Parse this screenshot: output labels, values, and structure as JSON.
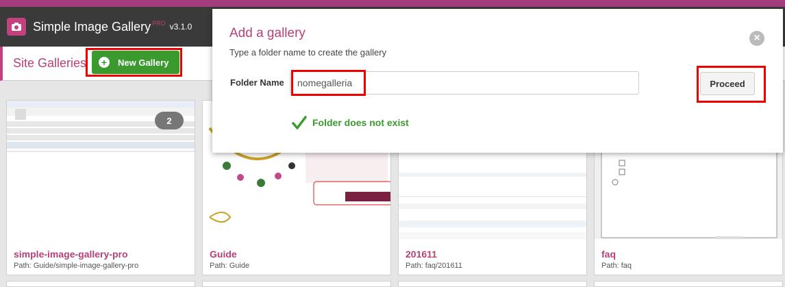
{
  "app": {
    "title": "Simple Image Gallery",
    "pro_label": "PRO",
    "version": "v3.1.0"
  },
  "subbar": {
    "site_galleries": "Site Galleries",
    "new_gallery_label": "New Gallery"
  },
  "cards": [
    {
      "name": "simple-image-gallery-pro",
      "path": "Path: Guide/simple-image-gallery-pro",
      "badge": "2"
    },
    {
      "name": "Guide",
      "path": "Path: Guide",
      "thumb_text": "Aggiungi al Carrello"
    },
    {
      "name": "201611",
      "path": "Path: faq/201611",
      "thumb_text": "% del tuo Catalogo"
    },
    {
      "name": "faq",
      "path": "Path: faq",
      "thumb_text": "Memorizza password"
    }
  ],
  "modal": {
    "title": "Add a gallery",
    "subtitle": "Type a folder name to create the gallery",
    "folder_label": "Folder Name",
    "folder_value": "nomegalleria",
    "proceed_label": "Proceed",
    "status_text": "Folder does not exist"
  },
  "colors": {
    "accent": "#b6407a",
    "topbar": "#3a3a3a",
    "success": "#3a9a2e",
    "highlight": "#e00000"
  },
  "icons": {
    "logo": "camera-icon",
    "new_gallery": "plus-circle-icon",
    "close": "close-icon",
    "status": "checkmark-icon"
  }
}
